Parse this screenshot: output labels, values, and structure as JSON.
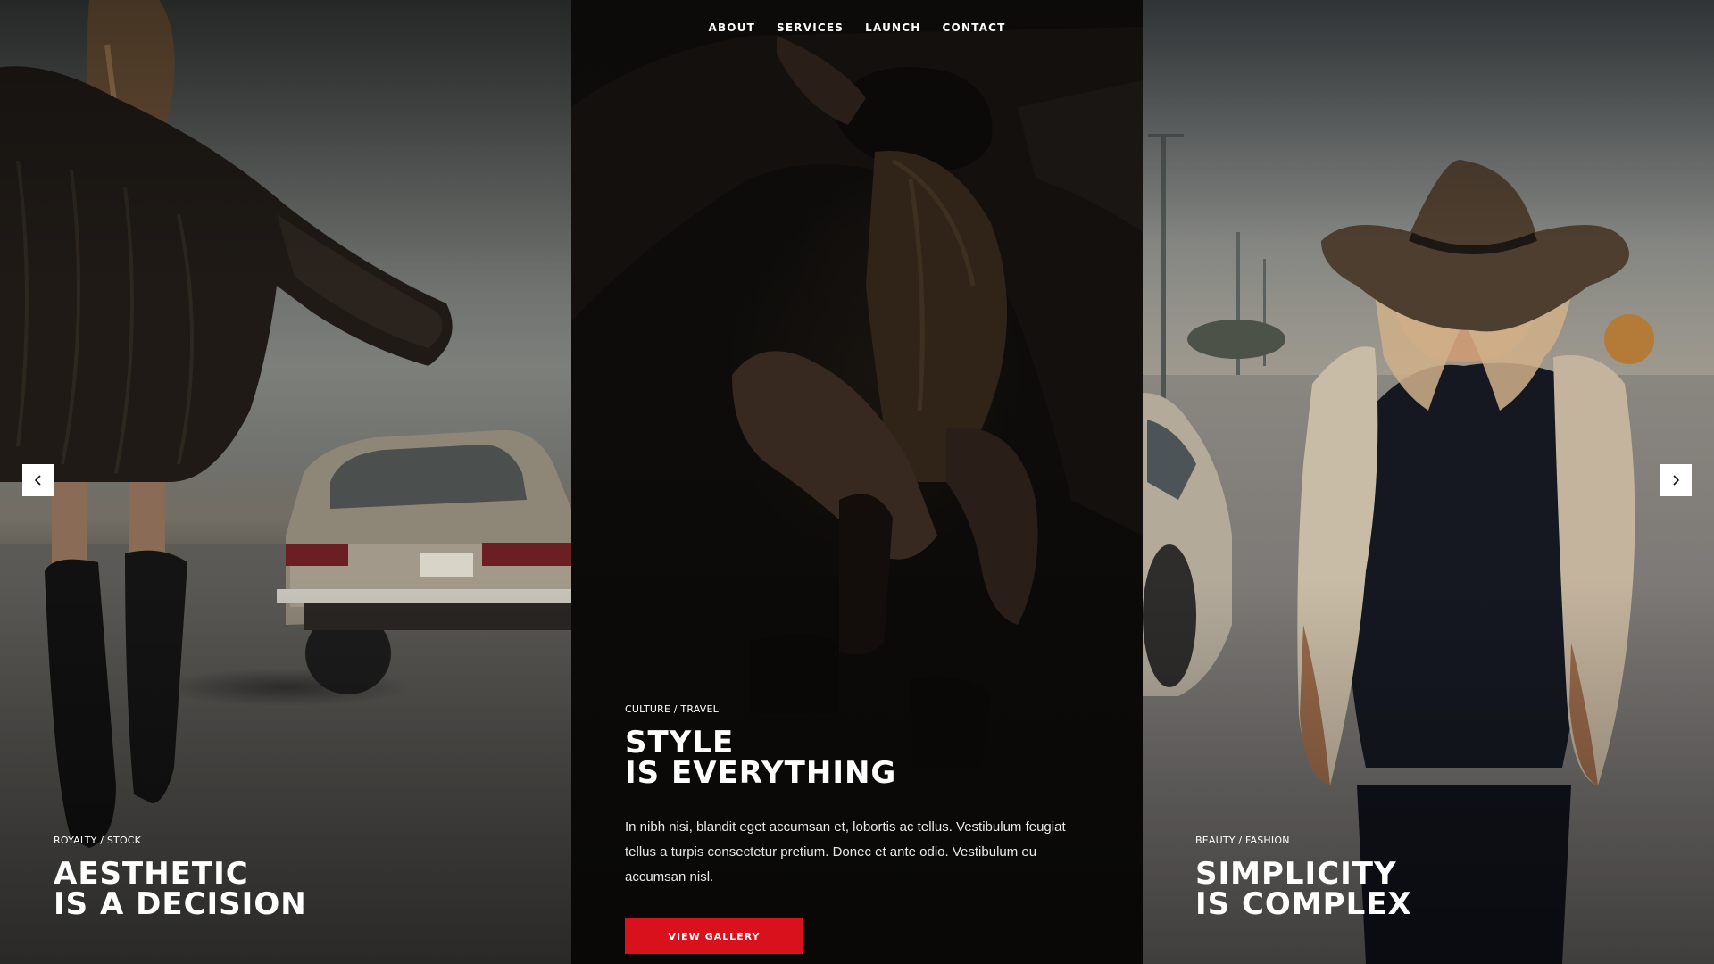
{
  "nav": {
    "items": [
      {
        "label": "ABOUT"
      },
      {
        "label": "SERVICES"
      },
      {
        "label": "LAUNCH"
      },
      {
        "label": "CONTACT"
      }
    ]
  },
  "slides": {
    "left": {
      "category": "ROYALTY / STOCK",
      "headline_line1": "AESTHETIC",
      "headline_line2": "IS A DECISION"
    },
    "center": {
      "category": "CULTURE / TRAVEL",
      "headline_line1": "STYLE",
      "headline_line2": "IS EVERYTHING",
      "body": "In nibh nisi, blandit eget accumsan et, lobortis ac tellus. Vestibulum feugiat tellus a turpis consectetur pretium. Donec et ante odio. Vestibulum eu accumsan nisl.",
      "button_label": "VIEW GALLERY"
    },
    "right": {
      "category": "BEAUTY / FASHION",
      "headline_line1": "SIMPLICITY",
      "headline_line2": "IS COMPLEX"
    }
  },
  "controls": {
    "prev_icon": "chevron-left-icon",
    "next_icon": "chevron-right-icon"
  },
  "colors": {
    "accent": "#d8111d",
    "text": "#ffffff",
    "overlay": "#000000"
  }
}
